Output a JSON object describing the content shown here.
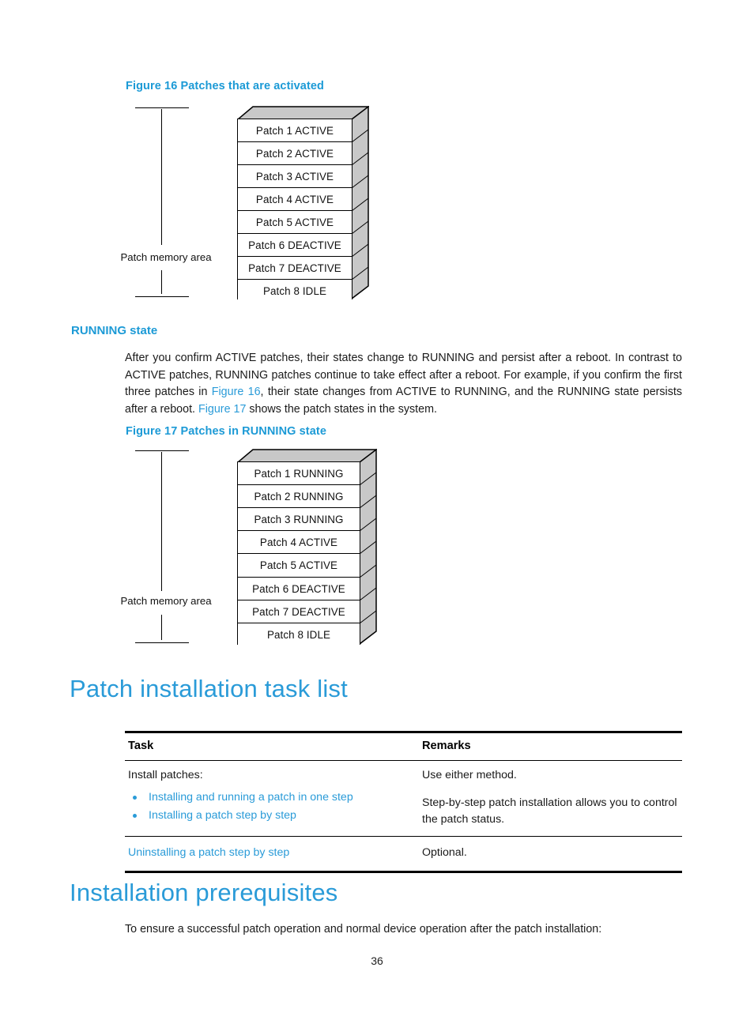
{
  "figure16": {
    "caption": "Figure 16 Patches that are activated",
    "memory_label": "Patch memory area",
    "rows": [
      "Patch 1 ACTIVE",
      "Patch 2 ACTIVE",
      "Patch 3 ACTIVE",
      "Patch 4 ACTIVE",
      "Patch 5 ACTIVE",
      "Patch 6 DEACTIVE",
      "Patch 7 DEACTIVE",
      "Patch 8 IDLE"
    ]
  },
  "running_section": {
    "heading": "RUNNING state",
    "para_part1": "After you confirm ACTIVE patches, their states change to RUNNING and persist after a reboot. In contrast to ACTIVE patches, RUNNING patches continue to take effect after a reboot. For example, if you confirm the first three patches in ",
    "link1": "Figure 16",
    "para_part2": ", their state changes from ACTIVE to RUNNING, and the RUNNING state persists after a reboot. ",
    "link2": "Figure 17",
    "para_part3": " shows the patch states in the system."
  },
  "figure17": {
    "caption": "Figure 17 Patches in RUNNING state",
    "memory_label": "Patch memory area",
    "rows": [
      "Patch 1 RUNNING",
      "Patch 2 RUNNING",
      "Patch 3 RUNNING",
      "Patch 4 ACTIVE",
      "Patch 5 ACTIVE",
      "Patch 6 DEACTIVE",
      "Patch 7 DEACTIVE",
      "Patch 8 IDLE"
    ]
  },
  "task_list_section": {
    "heading": "Patch installation task list",
    "table": {
      "headers": [
        "Task",
        "Remarks"
      ],
      "row1": {
        "task_intro": "Install patches:",
        "bullets": [
          "Installing and running a patch in one step",
          "Installing a patch step by step"
        ],
        "remark_line1": "Use either method.",
        "remark_line2": "Step-by-step patch installation allows you to control the patch status."
      },
      "row2": {
        "task_link": "Uninstalling a patch step by step",
        "remark": "Optional."
      }
    }
  },
  "prereq_section": {
    "heading": "Installation prerequisites",
    "paragraph": "To ensure a successful patch operation and normal device operation after the patch installation:"
  },
  "footer": {
    "page_number": "36"
  },
  "colors": {
    "heading_blue": "#2A9BD8",
    "caption_blue": "#1C9AD6",
    "stack_gray": "#C8C8C8"
  }
}
